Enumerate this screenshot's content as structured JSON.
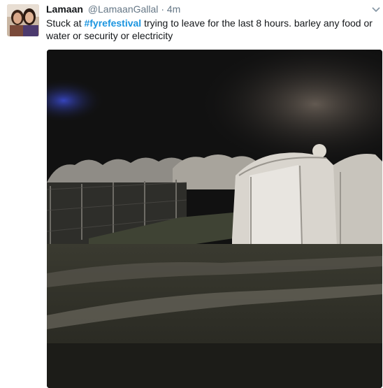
{
  "tweet": {
    "display_name": "Lamaan",
    "handle": "@LamaanGallal",
    "separator": "·",
    "time": "4m",
    "text_before": "Stuck at ",
    "hashtag": "#fyrefestival",
    "text_after": " trying to leave for the last 8 hours. barley any food or water or security or electricity"
  },
  "icons": {
    "caret": "chevron-down-icon"
  },
  "colors": {
    "link": "#1b95e0",
    "secondary_text": "#657786",
    "primary_text": "#14171a"
  }
}
